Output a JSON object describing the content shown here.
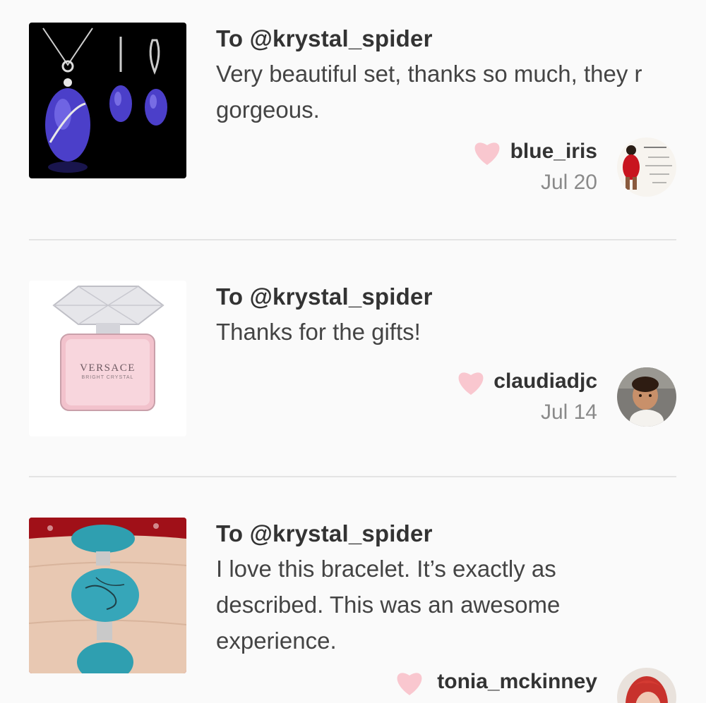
{
  "colors": {
    "background": "#fafafa",
    "heart": "#f9c7cf",
    "divider": "#e4e4e4",
    "date_text": "#8a8a8a"
  },
  "feed": {
    "entries": [
      {
        "recipient": "To @krystal_spider",
        "message": "Very beautiful set, thanks so much, they r gorgeous.",
        "username": "blue_iris",
        "date": "Jul 20",
        "thumbnail": "blue-crystal-jewelry-set-image",
        "avatar": "blue-iris-avatar"
      },
      {
        "recipient": "To @krystal_spider",
        "message": "Thanks for the gifts!",
        "username": "claudiadjc",
        "date": "Jul 14",
        "thumbnail": "perfume-bottle-image",
        "avatar": "claudiadjc-avatar",
        "thumbnail_text": {
          "brand": "VERSACE",
          "product": "BRIGHT CRYSTAL"
        }
      },
      {
        "recipient": "To @krystal_spider",
        "message": "I love this bracelet. It’s exactly as described. This was an awesome experience.",
        "username": "tonia_mckinney",
        "date": "",
        "thumbnail": "turquoise-bracelet-image",
        "avatar": "tonia-mckinney-avatar"
      }
    ]
  },
  "icons": {
    "like": "heart-icon"
  }
}
